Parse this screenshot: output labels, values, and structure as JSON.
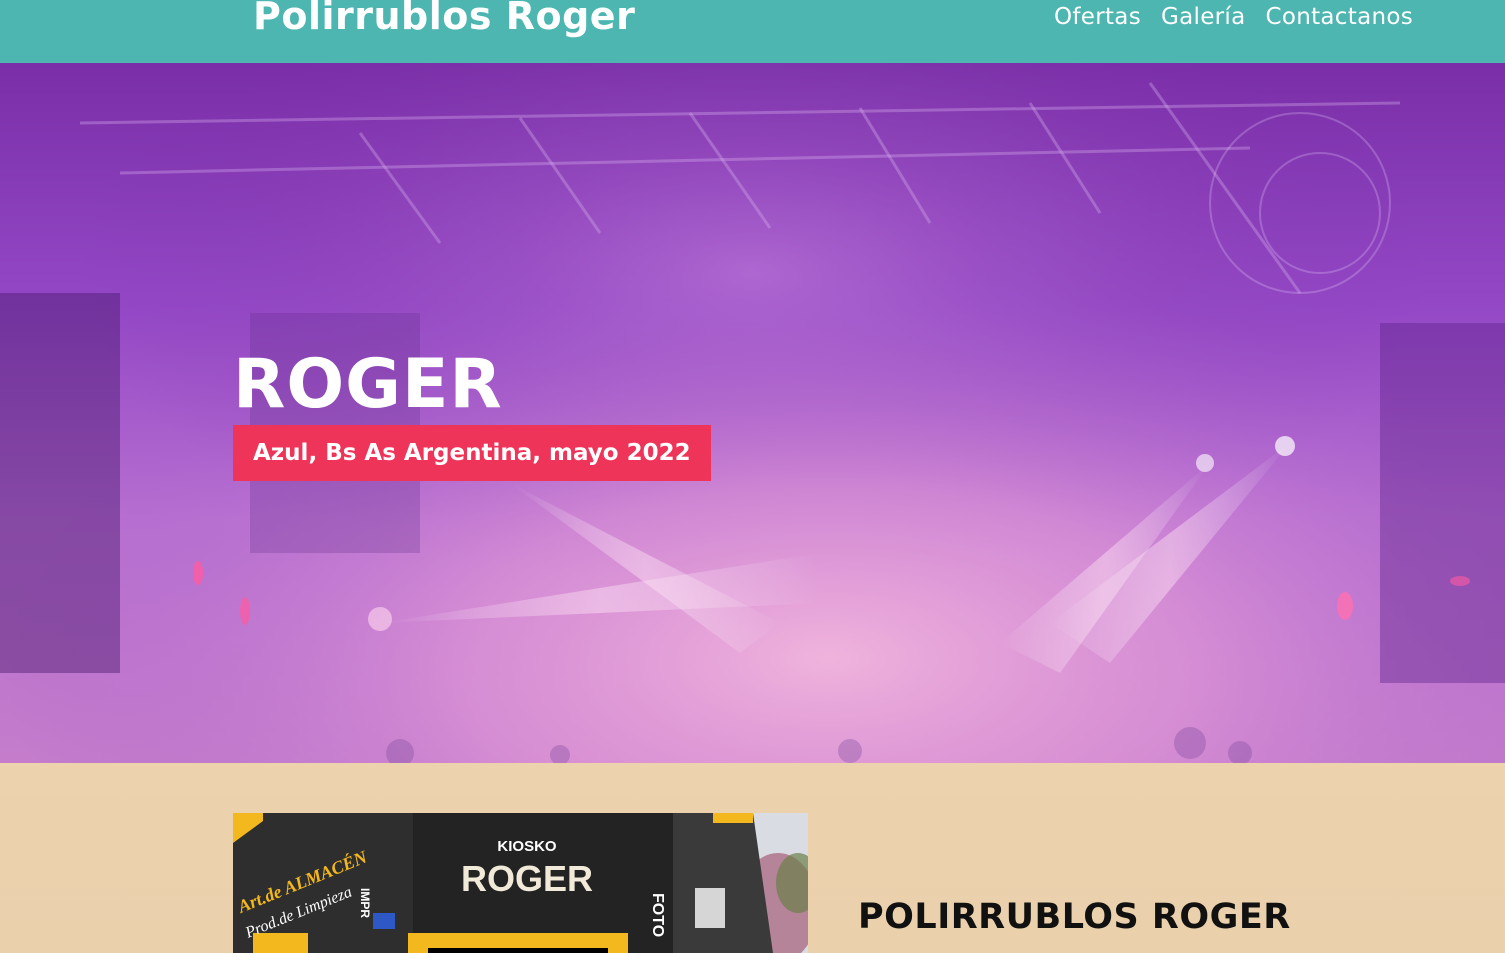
{
  "header": {
    "brand": "Polirrublos Roger",
    "nav": [
      "Ofertas",
      "Galería",
      "Contactanos"
    ]
  },
  "hero": {
    "title": "ROGER",
    "subtitle": "Azul, Bs As Argentina, mayo 2022"
  },
  "section": {
    "title": "POLIRRUBLOS ROGER",
    "photo_signs": {
      "kiosko": "KIOSKO",
      "roger": "ROGER",
      "almacen": "Art.de ALMACÉN",
      "limpieza": "Prod.de Limpieza",
      "impr": "IMPR",
      "foto": "FOTO"
    }
  },
  "colors": {
    "header_bg": "#4db6b0",
    "badge_bg": "#ef3459",
    "section_bg": "#ebcfab"
  }
}
